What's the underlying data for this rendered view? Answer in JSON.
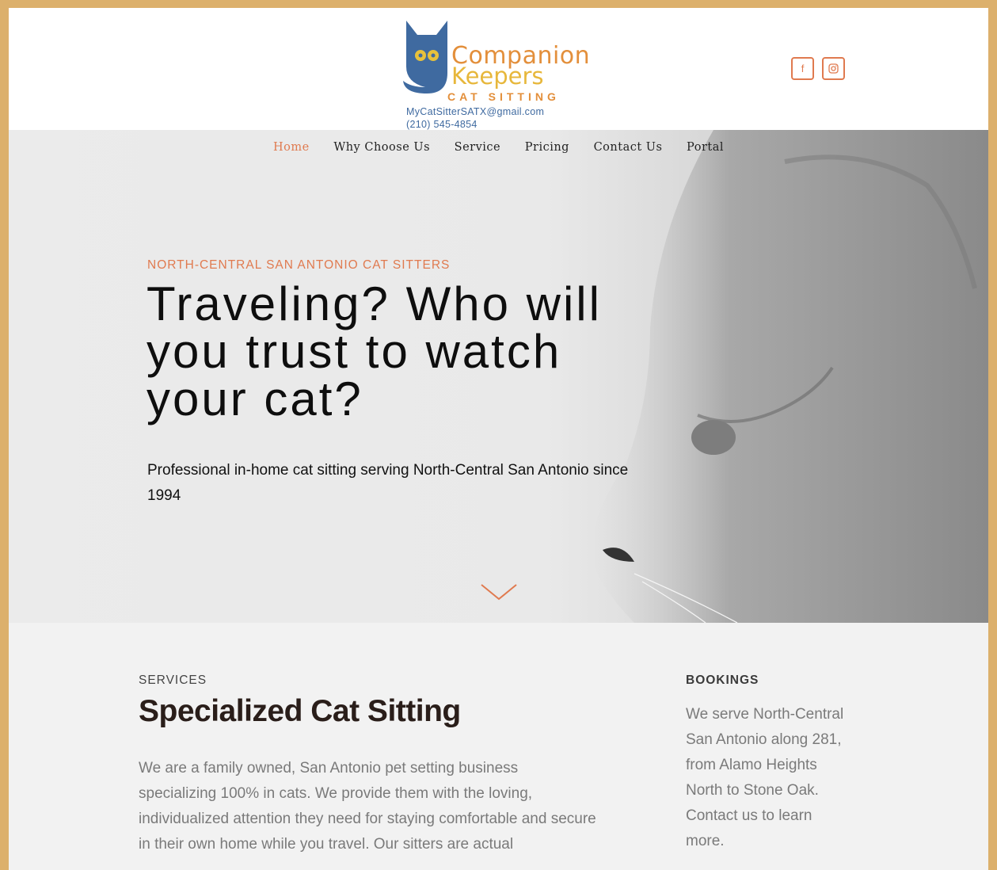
{
  "header": {
    "logo": {
      "line1": "Companion",
      "line2": "Keepers",
      "line3": "CAT SITTING",
      "email": "MyCatSitterSATX@gmail.com",
      "phone": "(210) 545-4854"
    },
    "social": [
      {
        "icon": "facebook-icon",
        "glyph": "f"
      },
      {
        "icon": "instagram-icon"
      }
    ]
  },
  "nav": {
    "items": [
      "Home",
      "Why Choose Us",
      "Service",
      "Pricing",
      "Contact Us",
      "Portal"
    ],
    "active": "Home"
  },
  "hero": {
    "kicker": "NORTH-CENTRAL SAN ANTONIO CAT SITTERS",
    "headline": "Traveling? Who will you trust to watch your cat?",
    "subtext": "Professional in-home cat sitting serving North-Central San Antonio since 1994"
  },
  "services": {
    "label": "SERVICES",
    "title": "Specialized Cat Sitting",
    "text": "We are a family owned, San Antonio pet setting business specializing 100% in cats. We provide them with the loving, individualized attention they need for staying comfortable and secure in their own home while you travel. Our sitters are actual"
  },
  "bookings": {
    "label": "BOOKINGS",
    "text": "We serve North-Central San Antonio along 281, from Alamo Heights North to Stone Oak. Contact us to learn more."
  },
  "colors": {
    "accent": "#e07a4f",
    "border": "#dcb06c",
    "logo_blue": "#3f6aa0",
    "logo_orange": "#e38f3b",
    "logo_yellow": "#e7b73b"
  }
}
